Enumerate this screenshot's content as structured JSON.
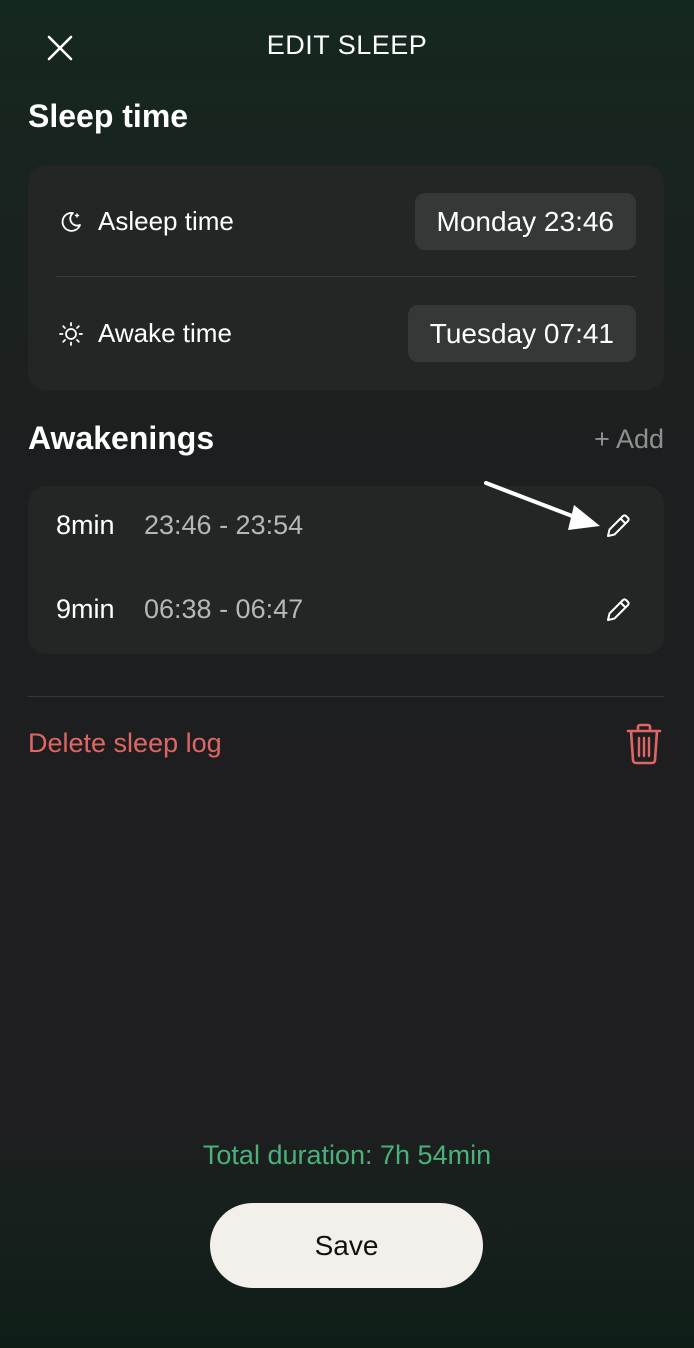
{
  "header": {
    "title": "EDIT SLEEP"
  },
  "sleep_time": {
    "title": "Sleep time",
    "asleep": {
      "label": "Asleep time",
      "value": "Monday 23:46",
      "icon": "moon-icon"
    },
    "awake": {
      "label": "Awake time",
      "value": "Tuesday 07:41",
      "icon": "sun-icon"
    }
  },
  "awakenings": {
    "title": "Awakenings",
    "add_label": "+ Add",
    "items": [
      {
        "duration": "8min",
        "range": "23:46 - 23:54"
      },
      {
        "duration": "9min",
        "range": "06:38 - 06:47"
      }
    ]
  },
  "delete": {
    "label": "Delete sleep log"
  },
  "total": {
    "text": "Total duration: 7h 54min"
  },
  "save": {
    "label": "Save"
  },
  "colors": {
    "accent_green": "#4cb07a",
    "danger_red": "#e06666",
    "card_bg": "#232625",
    "save_bg": "#f3f0eb"
  }
}
